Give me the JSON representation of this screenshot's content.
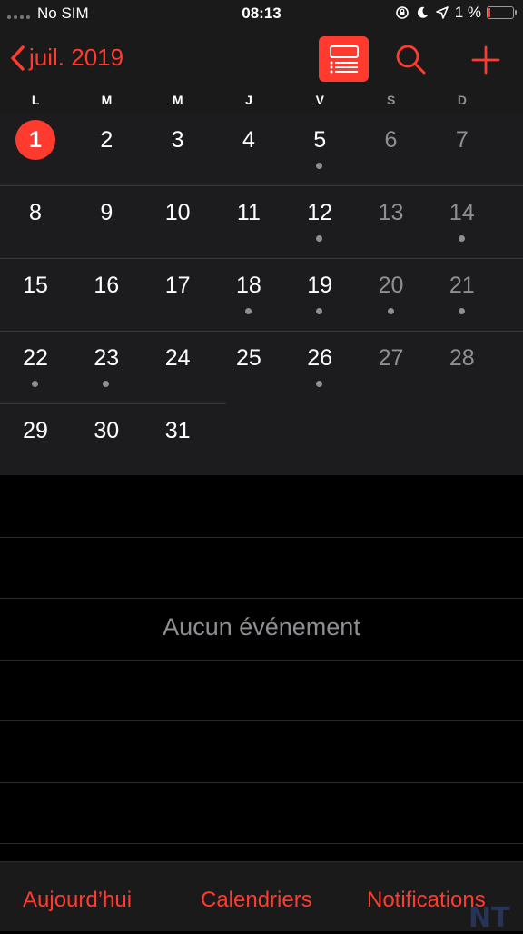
{
  "status_bar": {
    "carrier": "No SIM",
    "time": "08:13",
    "battery_percent": "1 %",
    "icons": [
      "signal-dots-icon",
      "rotation-lock-icon",
      "moon-icon",
      "location-arrow-icon",
      "battery-icon"
    ]
  },
  "header": {
    "back_label": "juil. 2019",
    "accent_color": "#ff3b30",
    "icons": [
      "chevron-left-icon",
      "list-view-icon",
      "search-icon",
      "plus-icon"
    ]
  },
  "weekdays": [
    "L",
    "M",
    "M",
    "J",
    "V",
    "S",
    "D"
  ],
  "calendar": {
    "weeks": [
      [
        {
          "d": "1",
          "today": true,
          "dot": false
        },
        {
          "d": "2",
          "dot": false
        },
        {
          "d": "3",
          "dot": false
        },
        {
          "d": "4",
          "dot": false
        },
        {
          "d": "5",
          "dot": true
        },
        {
          "d": "6",
          "dot": false
        },
        {
          "d": "7",
          "dot": false
        }
      ],
      [
        {
          "d": "8",
          "dot": false
        },
        {
          "d": "9",
          "dot": false
        },
        {
          "d": "10",
          "dot": false
        },
        {
          "d": "11",
          "dot": false
        },
        {
          "d": "12",
          "dot": true
        },
        {
          "d": "13",
          "dot": false
        },
        {
          "d": "14",
          "dot": true
        }
      ],
      [
        {
          "d": "15",
          "dot": false
        },
        {
          "d": "16",
          "dot": false
        },
        {
          "d": "17",
          "dot": false
        },
        {
          "d": "18",
          "dot": true
        },
        {
          "d": "19",
          "dot": true
        },
        {
          "d": "20",
          "dot": true
        },
        {
          "d": "21",
          "dot": true
        }
      ],
      [
        {
          "d": "22",
          "dot": true
        },
        {
          "d": "23",
          "dot": true
        },
        {
          "d": "24",
          "dot": false
        },
        {
          "d": "25",
          "dot": false
        },
        {
          "d": "26",
          "dot": true
        },
        {
          "d": "27",
          "dot": false
        },
        {
          "d": "28",
          "dot": false
        }
      ],
      [
        {
          "d": "29",
          "dot": false
        },
        {
          "d": "30",
          "dot": false
        },
        {
          "d": "31",
          "dot": false
        }
      ]
    ]
  },
  "events": {
    "empty_message": "Aucun événement"
  },
  "tabbar": {
    "today": "Aujourd’hui",
    "calendars": "Calendriers",
    "notifications": "Notifications"
  },
  "watermark": "NT"
}
